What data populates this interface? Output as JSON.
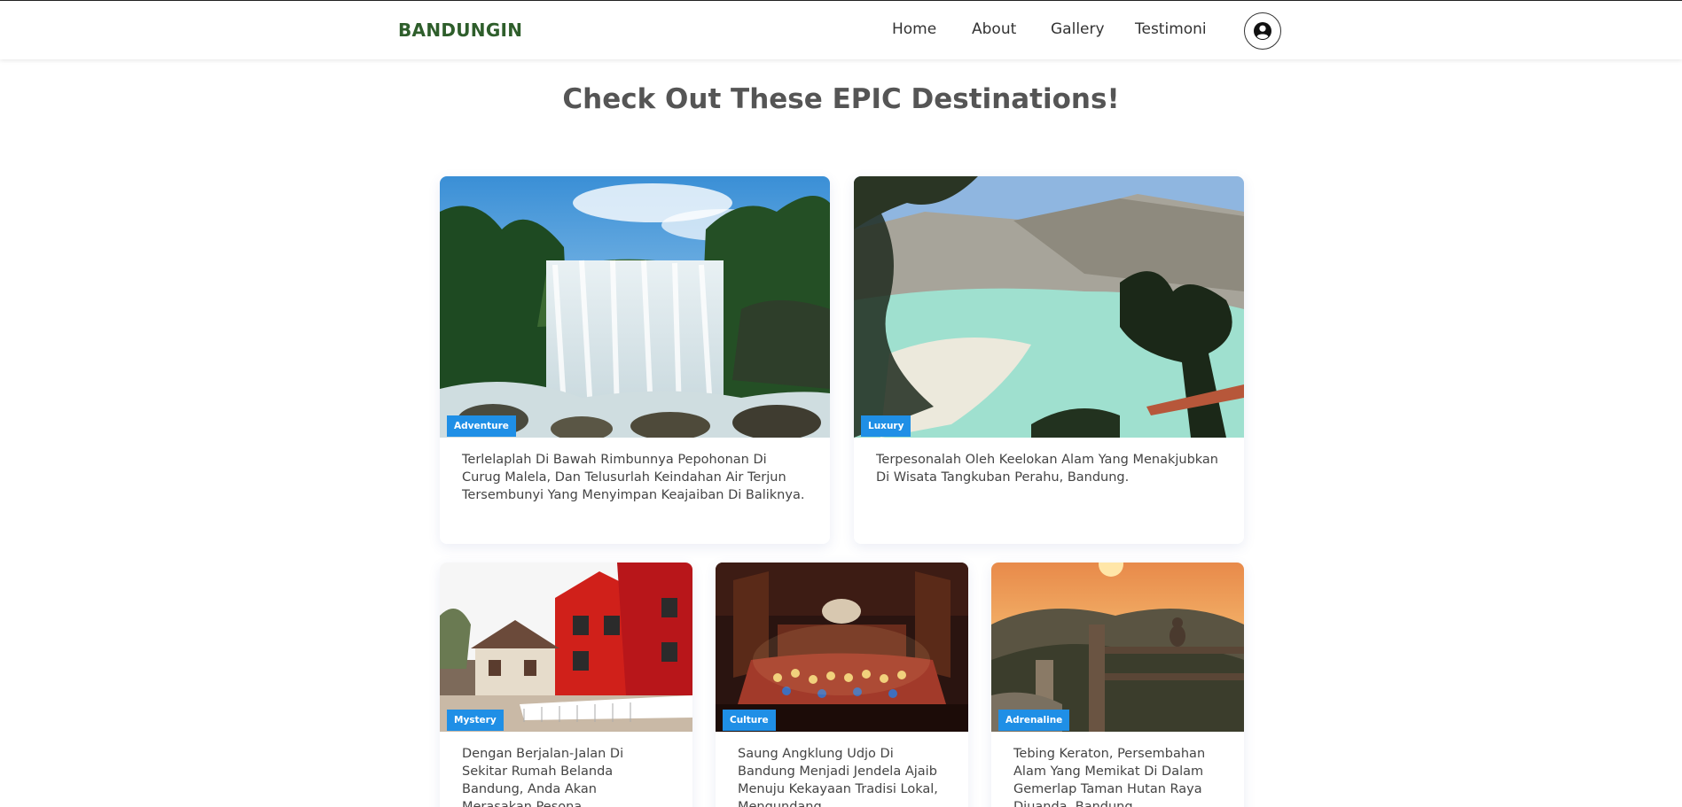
{
  "nav": {
    "brand": "BANDUNGIN",
    "links": [
      "Home",
      "About",
      "Gallery",
      "Testimoni"
    ],
    "profile_icon": "user-circle-icon"
  },
  "main": {
    "title": "Check Out These EPIC Destinations!"
  },
  "cards": [
    {
      "badge": "Adventure",
      "text": "Terlelaplah Di Bawah Rimbunnya Pepohonan Di Curug Malela, Dan Telusurlah Keindahan Air Terjun Tersembunyi Yang Menyimpan Keajaiban Di Baliknya.",
      "image": "waterfall"
    },
    {
      "badge": "Luxury",
      "text": "Terpesonalah Oleh Keelokan Alam Yang Menakjubkan Di Wisata Tangkuban Perahu, Bandung.",
      "image": "crater-lake"
    },
    {
      "badge": "Mystery",
      "text": "Dengan Berjalan-Jalan Di Sekitar Rumah Belanda Bandung, Anda Akan Merasakan Pesona",
      "image": "dutch-houses"
    },
    {
      "badge": "Culture",
      "text": "Saung Angklung Udjo Di Bandung Menjadi Jendela Ajaib Menuju Kekayaan Tradisi Lokal, Mengundang",
      "image": "angklung-performance"
    },
    {
      "badge": "Adrenaline",
      "text": "Tebing Keraton, Persembahan Alam Yang Memikat Di Dalam Gemerlap Taman Hutan Raya Djuanda, Bandung.",
      "image": "cliff-sunrise"
    }
  ],
  "colors": {
    "brand": "#2e5e2b",
    "badge": "#1f8fe6",
    "title": "#555555"
  }
}
